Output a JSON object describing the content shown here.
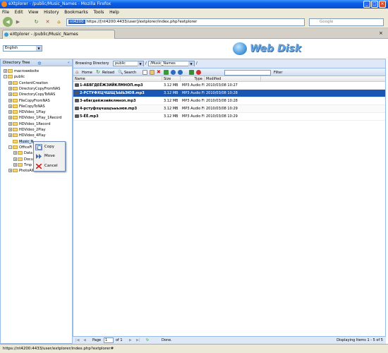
{
  "window": {
    "title": "eXtplorer - /public/Music_Names - Mozilla Firefox"
  },
  "menu": [
    "File",
    "Edit",
    "View",
    "History",
    "Bookmarks",
    "Tools",
    "Help"
  ],
  "nav": {
    "site_badge": "nt4200",
    "url": "https://[nt4200:4433/user]/extplorer/index.php?extplorer",
    "search_placeholder": "Google"
  },
  "tab": {
    "label": "eXtplorer - /public/Music_Names"
  },
  "header": {
    "language": "English",
    "logo_text": "Web Disk"
  },
  "tree": {
    "title": "Directory Tree",
    "nodes": [
      {
        "label": "macrowebsite",
        "level": 0,
        "exp": "+"
      },
      {
        "label": "public",
        "level": 0,
        "exp": "-"
      },
      {
        "label": "ContentCreation",
        "level": 1,
        "exp": "+"
      },
      {
        "label": "DirectoryCopyFromNAS",
        "level": 1,
        "exp": "+"
      },
      {
        "label": "DirectoryCopyToNAS",
        "level": 1,
        "exp": "+"
      },
      {
        "label": "FileCopyFromNAS",
        "level": 1,
        "exp": "+"
      },
      {
        "label": "FileCopyToNAS",
        "level": 1,
        "exp": "+"
      },
      {
        "label": "HDVideo_1Play",
        "level": 1,
        "exp": "+"
      },
      {
        "label": "HDVideo_1Play_1Record",
        "level": 1,
        "exp": "+"
      },
      {
        "label": "HDVideo_1Record",
        "level": 1,
        "exp": "+"
      },
      {
        "label": "HDVideo_2Play",
        "level": 1,
        "exp": "+"
      },
      {
        "label": "HDVideo_4Play",
        "level": 1,
        "exp": "+"
      },
      {
        "label": "Music_N",
        "level": 1,
        "exp": "",
        "selected": true
      },
      {
        "label": "OfficeFi",
        "level": 1,
        "exp": "-"
      },
      {
        "label": "Data",
        "level": 2,
        "exp": "+"
      },
      {
        "label": "Docu",
        "level": 2,
        "exp": "+"
      },
      {
        "label": "Tmp",
        "level": 2,
        "exp": "+"
      },
      {
        "label": "PhotoAlbum",
        "level": 1,
        "exp": "+"
      }
    ]
  },
  "context_menu": [
    {
      "label": "Copy",
      "icon": "copy-icon"
    },
    {
      "label": "Move",
      "icon": "move-icon"
    },
    {
      "label": "Cancel",
      "icon": "cancel-icon"
    }
  ],
  "browse": {
    "label": "Browsing Directory",
    "root": "public",
    "path": "/Music_Names",
    "sep": "/"
  },
  "toolbar": {
    "home": "Home",
    "reload": "Reload",
    "search": "Search",
    "filter": "Filter"
  },
  "grid": {
    "columns": [
      "Name",
      "Size",
      "Type",
      "Modified"
    ],
    "rows": [
      {
        "name": "1-АБВГДЕЁЖЗИЙКЛМНОП.mp3",
        "size": "3.12 MB",
        "type": "MP3 Audio Fi",
        "modified": "2010/03/08 10:27"
      },
      {
        "name": "2-РСТУФХЦЧШЩЪЫЬЭЮЯ.mp3",
        "size": "3.12 MB",
        "type": "MP3 Audio Fi",
        "modified": "2010/03/08 10:28"
      },
      {
        "name": "3-абвгдеёжзийклмноп.mp3",
        "size": "3.12 MB",
        "type": "MP3 Audio Fi",
        "modified": "2010/03/08 10:28"
      },
      {
        "name": "4-рстуфхцчшщъыьэюя.mp3",
        "size": "3.12 MB",
        "type": "MP3 Audio Fi",
        "modified": "2010/03/08 10:29"
      },
      {
        "name": "5-ÉÈ.mp3",
        "size": "3.12 MB",
        "type": "MP3 Audio Fi",
        "modified": "2010/03/08 10:29"
      }
    ],
    "selected_index": 1
  },
  "pager": {
    "page_label": "Page",
    "page": "1",
    "of": "of 1",
    "done": "Done.",
    "summary": "Displaying Items 1 - 5 of 5"
  },
  "status": {
    "url": "https://nt4200:4433/user/extplorer/index.php?extplorer#"
  }
}
